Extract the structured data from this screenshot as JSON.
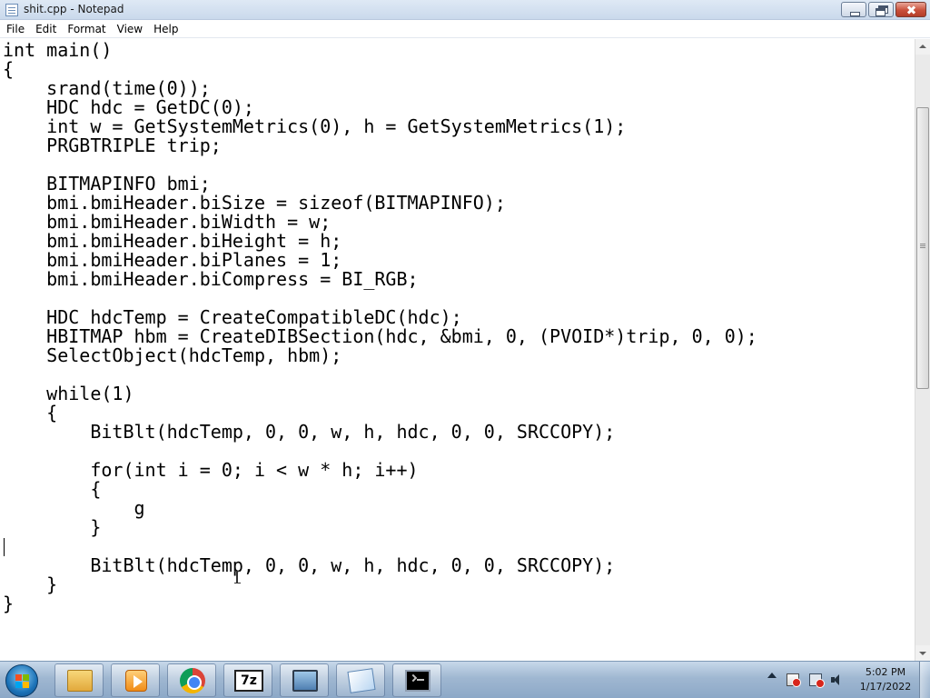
{
  "window": {
    "title": "shit.cpp - Notepad"
  },
  "menu": {
    "items": [
      "File",
      "Edit",
      "Format",
      "View",
      "Help"
    ]
  },
  "editor": {
    "lines": [
      "int main()",
      "{",
      "    srand(time(0));",
      "    HDC hdc = GetDC(0);",
      "    int w = GetSystemMetrics(0), h = GetSystemMetrics(1);",
      "    PRGBTRIPLE trip;",
      "",
      "    BITMAPINFO bmi;",
      "    bmi.bmiHeader.biSize = sizeof(BITMAPINFO);",
      "    bmi.bmiHeader.biWidth = w;",
      "    bmi.bmiHeader.biHeight = h;",
      "    bmi.bmiHeader.biPlanes = 1;",
      "    bmi.bmiHeader.biCompress = BI_RGB;",
      "",
      "    HDC hdcTemp = CreateCompatibleDC(hdc);",
      "    HBITMAP hbm = CreateDIBSection(hdc, &bmi, 0, (PVOID*)trip, 0, 0);",
      "    SelectObject(hdcTemp, hbm);",
      "",
      "    while(1)",
      "    {",
      "        BitBlt(hdcTemp, 0, 0, w, h, hdc, 0, 0, SRCCOPY);",
      "",
      "        for(int i = 0; i < w * h; i++)",
      "        {",
      "            g",
      "        }",
      "",
      "        BitBlt(hdcTemp, 0, 0, w, h, hdc, 0, 0, SRCCOPY);",
      "    }",
      "}"
    ]
  },
  "taskbar": {
    "pinned": [
      {
        "icon": "explorer-icon"
      },
      {
        "icon": "media-player-icon"
      },
      {
        "icon": "chrome-icon"
      },
      {
        "icon": "7zip-icon",
        "label": "7z"
      },
      {
        "icon": "monitor-icon"
      },
      {
        "icon": "notepad-icon"
      },
      {
        "icon": "cmd-icon"
      }
    ],
    "clock": {
      "time": "5:02 PM",
      "date": "1/17/2022"
    }
  }
}
